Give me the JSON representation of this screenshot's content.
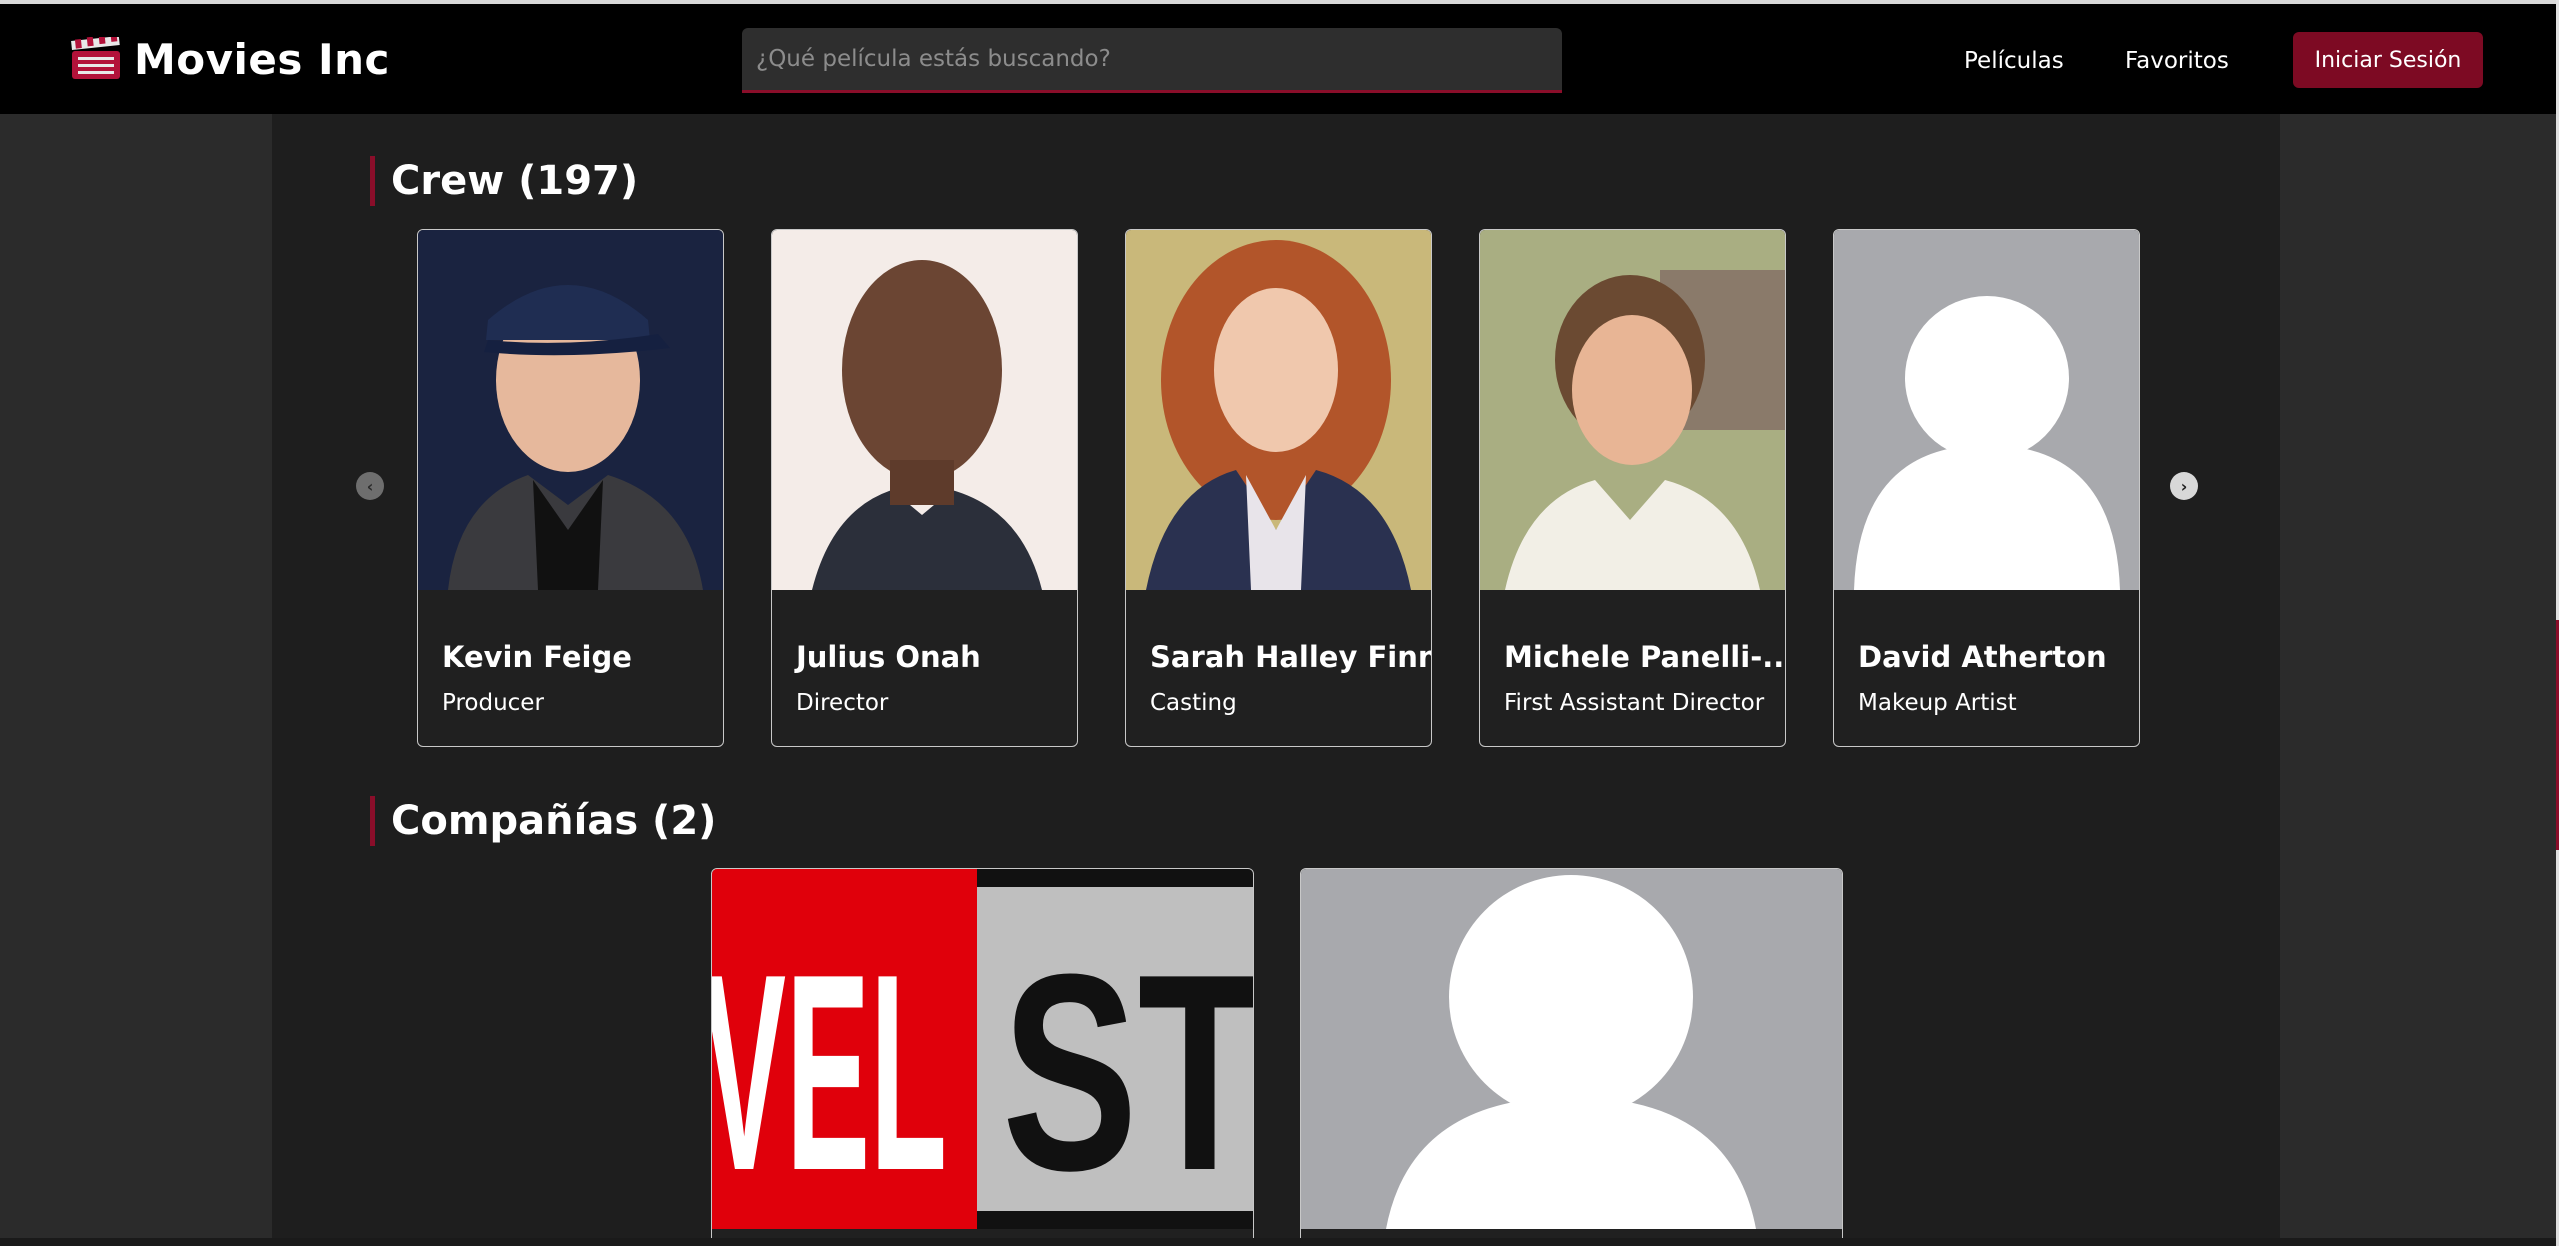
{
  "colors": {
    "accent": "#7d0a23",
    "navbar_bg": "#000000",
    "page_bg": "#2b2b2b",
    "content_bg": "#1e1e1e"
  },
  "navbar": {
    "brand_icon": "clapperboard-icon",
    "brand_title": "Movies Inc",
    "search_placeholder": "¿Qué película estás buscando?",
    "links": [
      "Películas",
      "Favoritos"
    ],
    "login_label": "Iniciar Sesión"
  },
  "crew": {
    "title": "Crew (197)",
    "prev_icon": "chevron-left-icon",
    "next_icon": "chevron-right-icon",
    "members": [
      {
        "name": "Kevin Feige",
        "role": "Producer"
      },
      {
        "name": "Julius Onah",
        "role": "Director"
      },
      {
        "name": "Sarah Halley Finn",
        "role": "Casting"
      },
      {
        "name": "Michele Panelli-...",
        "role": "First Assistant Director"
      },
      {
        "name": "David Atherton",
        "role": "Makeup Artist"
      }
    ]
  },
  "companies": {
    "title": "Compañías (2)",
    "logo_text": [
      "VEL",
      "ST"
    ]
  }
}
